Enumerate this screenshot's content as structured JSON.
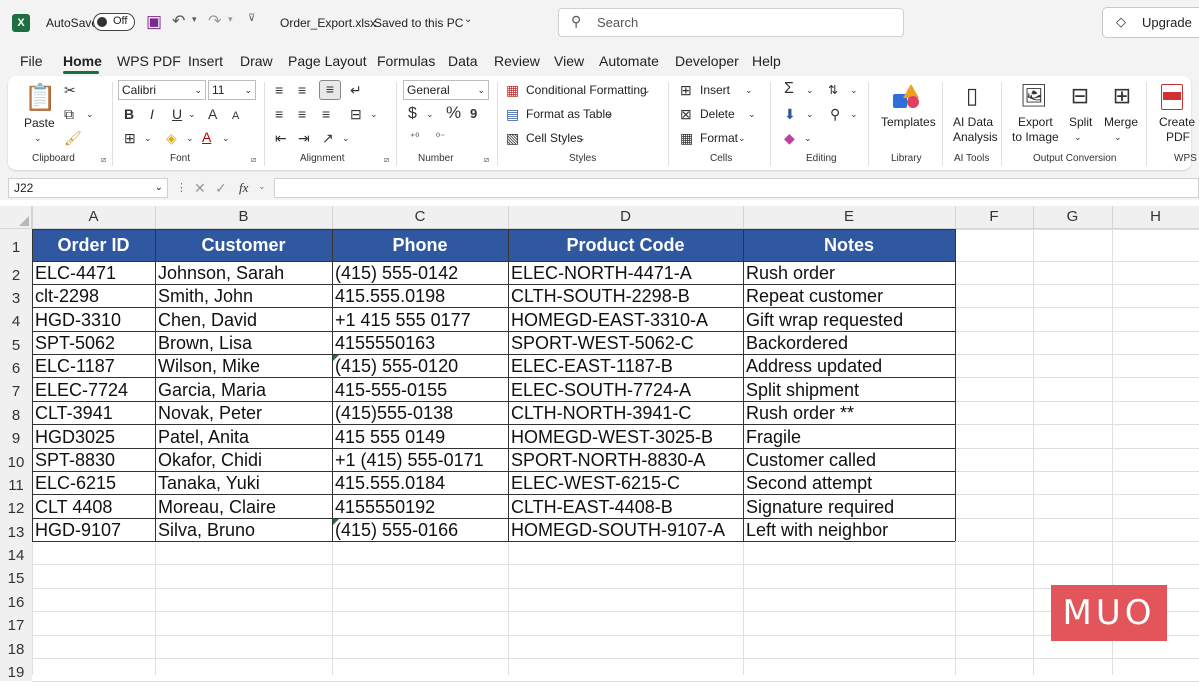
{
  "titlebar": {
    "autosave_label": "AutoSave",
    "autosave_state": "Off",
    "file_name": "Order_Export.xlsx",
    "save_status": "Saved to this PC",
    "search_placeholder": "Search",
    "upgrade_label": "Upgrade"
  },
  "menu_tabs": [
    "File",
    "Home",
    "WPS PDF",
    "Insert",
    "Draw",
    "Page Layout",
    "Formulas",
    "Data",
    "Review",
    "View",
    "Automate",
    "Developer",
    "Help"
  ],
  "active_tab": "Home",
  "ribbon": {
    "clipboard": {
      "paste": "Paste",
      "label": "Clipboard"
    },
    "font": {
      "name": "Calibri",
      "size": "11",
      "label": "Font"
    },
    "alignment": {
      "label": "Alignment"
    },
    "number": {
      "format": "General",
      "label": "Number"
    },
    "styles": {
      "conditional": "Conditional Formatting",
      "table": "Format as Table",
      "cell_styles": "Cell Styles",
      "label": "Styles"
    },
    "cells": {
      "insert": "Insert",
      "delete": "Delete",
      "format": "Format",
      "label": "Cells"
    },
    "editing": {
      "label": "Editing"
    },
    "library": {
      "templates": "Templates",
      "label": "Library"
    },
    "ai_tools": {
      "line1": "AI Data",
      "line2": "Analysis",
      "label": "AI Tools"
    },
    "output": {
      "export1": "Export",
      "export2": "to Image",
      "split": "Split",
      "merge": "Merge",
      "label": "Output Conversion"
    },
    "wps": {
      "line1": "Create",
      "line2": "PDF",
      "label": "WPS"
    }
  },
  "formula_bar": {
    "name_box": "J22",
    "fx": "fx"
  },
  "columns": [
    "A",
    "B",
    "C",
    "D",
    "E",
    "F",
    "G",
    "H"
  ],
  "row_numbers": [
    "1",
    "2",
    "3",
    "4",
    "5",
    "6",
    "7",
    "8",
    "9",
    "10",
    "11",
    "12",
    "13",
    "14",
    "15",
    "16",
    "17",
    "18",
    "19"
  ],
  "table": {
    "headers": [
      "Order ID",
      "Customer",
      "Phone",
      "Product Code",
      "Notes"
    ],
    "rows": [
      [
        "ELC-4471",
        "Johnson, Sarah",
        "(415) 555-0142",
        "ELEC-NORTH-4471-A",
        "Rush order"
      ],
      [
        "clt-2298",
        "Smith,  John",
        "415.555.0198",
        "CLTH-SOUTH-2298-B",
        "Repeat  customer"
      ],
      [
        "HGD-3310",
        "Chen, David",
        "+1 415 555 0177",
        "HOMEGD-EAST-3310-A",
        "Gift wrap requested"
      ],
      [
        "SPT-5062",
        "Brown, Lisa",
        "4155550163",
        "SPORT-WEST-5062-C",
        "Backordered"
      ],
      [
        "ELC-1187",
        "Wilson, Mike",
        "(415) 555-0120",
        "ELEC-EAST-1187-B",
        "Address updated"
      ],
      [
        "ELEC-7724",
        "Garcia, Maria",
        "415-555-0155",
        "ELEC-SOUTH-7724-A",
        "Split  shipment"
      ],
      [
        "CLT-3941",
        "Novak, Peter",
        "(415)555-0138",
        "CLTH-NORTH-3941-C",
        "Rush order **"
      ],
      [
        "HGD3025",
        "Patel, Anita",
        "415 555 0149",
        "HOMEGD-WEST-3025-B",
        "Fragile"
      ],
      [
        "SPT-8830",
        "Okafor, Chidi",
        "+1 (415) 555-0171",
        "SPORT-NORTH-8830-A",
        "Customer called"
      ],
      [
        "ELC-6215",
        "Tanaka, Yuki",
        "415.555.0184",
        "ELEC-WEST-6215-C",
        "Second    attempt"
      ],
      [
        "CLT 4408",
        "Moreau, Claire",
        "4155550192",
        "CLTH-EAST-4408-B",
        "Signature required"
      ],
      [
        "HGD-9107",
        "Silva, Bruno",
        "(415) 555-0166",
        "HOMEGD-SOUTH-9107-A",
        "Left with neighbor"
      ]
    ]
  },
  "watermark": "MUO",
  "colors": {
    "header_fill": "#2f58a0",
    "header_text": "#ffffff",
    "accent": "#1f6b3c",
    "watermark": "#e2555b"
  }
}
